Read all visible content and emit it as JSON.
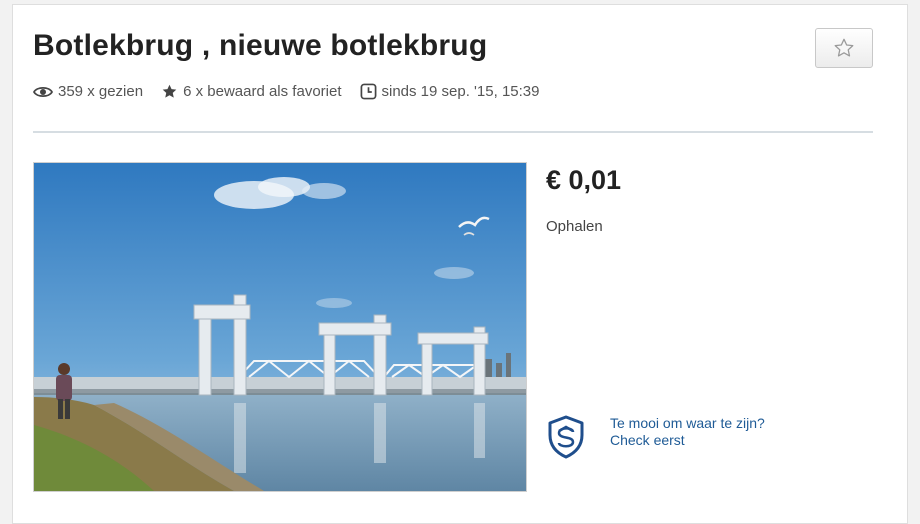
{
  "listing": {
    "title": "Botlekbrug , nieuwe botlekbrug",
    "views": "359 x gezien",
    "favorites": "6 x bewaard als favoriet",
    "since": "sinds 19 sep. '15, 15:39",
    "price": "€ 0,01",
    "delivery": "Ophalen"
  },
  "safety": {
    "line1": "Te mooi om waar te zijn?",
    "line2": "Check eerst"
  },
  "icons": {
    "views": "eye-icon",
    "favorites": "star-icon",
    "since": "clock-icon",
    "favorite_button": "star-outline-icon",
    "safety": "shield-icon"
  },
  "colors": {
    "link": "#1f5b96",
    "shield": "#1f4e8c",
    "sky": "#3f86c6"
  }
}
